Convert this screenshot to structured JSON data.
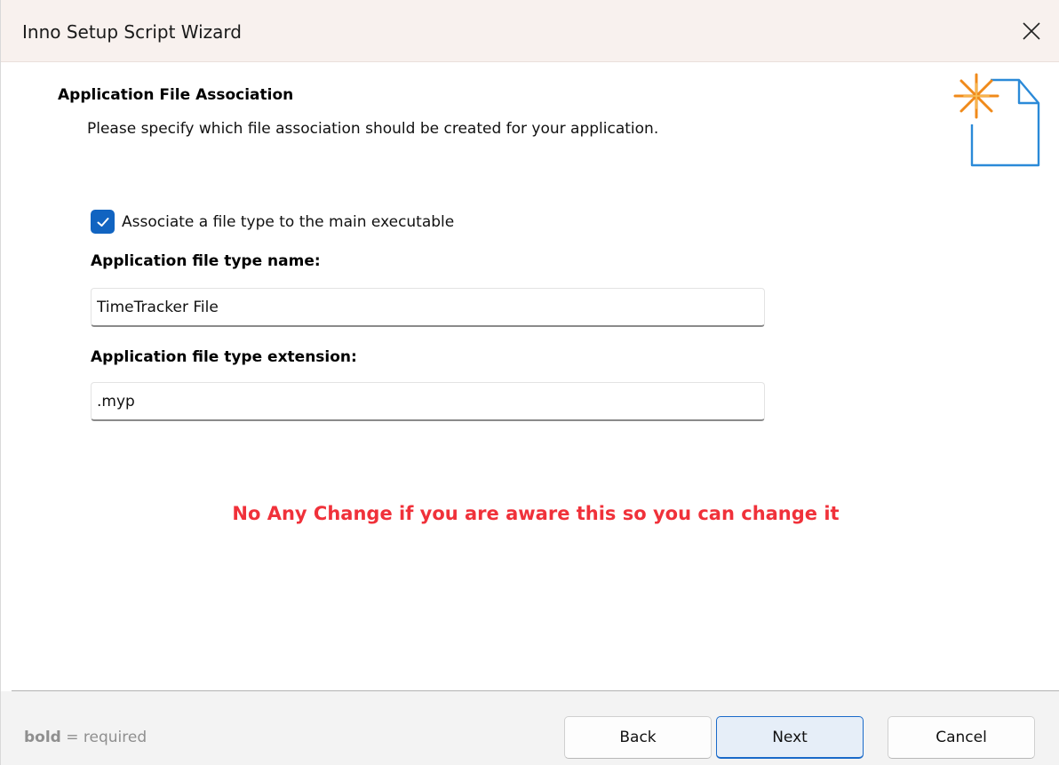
{
  "window": {
    "title": "Inno Setup Script Wizard"
  },
  "page": {
    "heading": "Application File Association",
    "description": "Please specify which file association should be created for your application."
  },
  "associate": {
    "checked": true,
    "label": "Associate a file type to the main executable"
  },
  "file_type_name": {
    "label": "Application file type name:",
    "value": "TimeTracker File"
  },
  "file_type_extension": {
    "label": "Application file type extension:",
    "value": ".myp"
  },
  "notice": "No Any Change if you are aware this so you can change it",
  "footer": {
    "legend_bold": "bold",
    "legend_rest": " = required",
    "back_label": "Back",
    "next_label": "Next",
    "cancel_label": "Cancel"
  },
  "colors": {
    "accent": "#1164c1",
    "notice": "#f0313a",
    "titlebar": "#f8f1ee",
    "icon_star": "#f08a1a",
    "icon_doc": "#2b8ad8"
  },
  "icons": {
    "close": "close-icon",
    "check": "check-icon",
    "document": "new-document-icon"
  }
}
